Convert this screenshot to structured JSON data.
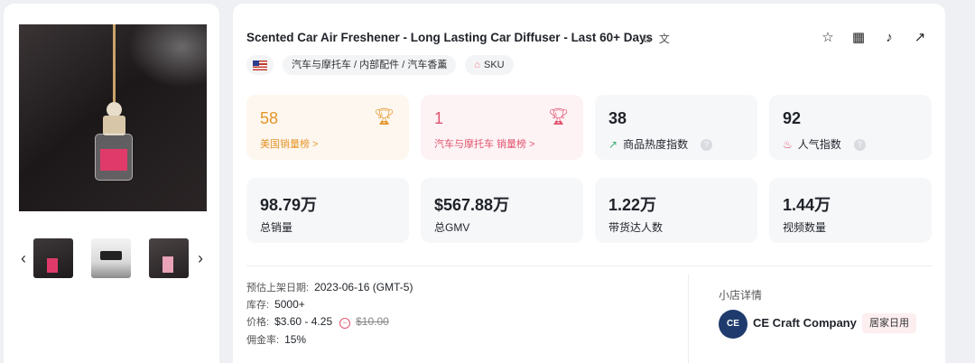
{
  "product": {
    "title": "Scented Car Air Freshener - Long Lasting Car Diffuser - Last 60+ Days",
    "category_path": "汽车与摩托车 / 内部配件 / 汽车香薰",
    "sku_label": "SKU"
  },
  "gallery": {
    "prev_arrow": "‹",
    "next_arrow": "›"
  },
  "icons": {
    "copy": "⧉",
    "translate": "文",
    "star": "☆",
    "qr": "▦",
    "tiktok": "♪",
    "external": "↗"
  },
  "stats": [
    {
      "value": "58",
      "label": "美国销量榜 >"
    },
    {
      "value": "1",
      "label": "汽车与摩托车 销量榜 >"
    },
    {
      "value": "38",
      "label": "商品热度指数"
    },
    {
      "value": "92",
      "label": "人气指数"
    },
    {
      "value": "98.79万",
      "label": "总销量"
    },
    {
      "value": "$567.88万",
      "label": "总GMV"
    },
    {
      "value": "1.22万",
      "label": "带货达人数"
    },
    {
      "value": "1.44万",
      "label": "视频数量"
    }
  ],
  "details": {
    "listed_key": "预估上架日期:",
    "listed_value": "2023-06-16 (GMT-5)",
    "stock_key": "库存:",
    "stock_value": "5000+",
    "price_key": "价格:",
    "price_value": "$3.60 - 4.25",
    "original_price": "$10.00",
    "commission_key": "佣金率:",
    "commission_value": "15%"
  },
  "shop": {
    "heading": "小店详情",
    "logo_text": "CE",
    "name": "CE Craft Company",
    "tag": "居家日用"
  },
  "colors": {
    "orange_accent": "#e5952a",
    "pink_accent": "#e2546f",
    "shop_logo": "#1f3b6e"
  }
}
